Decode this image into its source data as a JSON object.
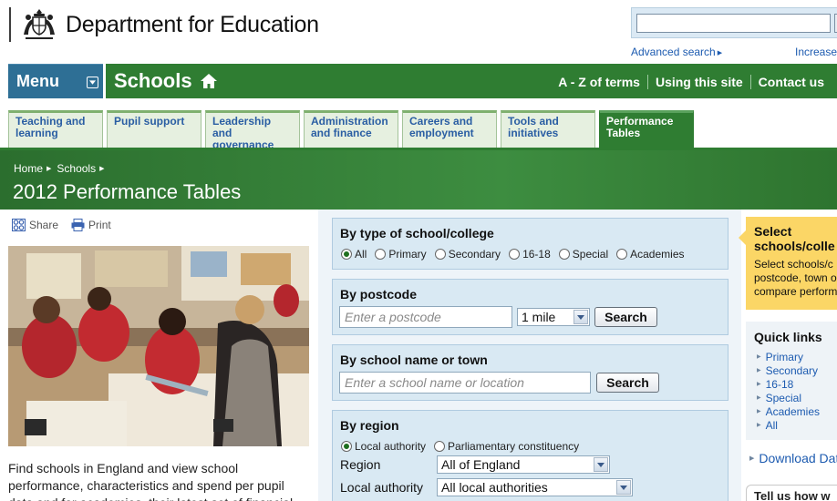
{
  "header": {
    "org_name": "Department for Education",
    "advanced_search": "Advanced search",
    "increase_text": "Increase"
  },
  "nav": {
    "menu_label": "Menu",
    "section_title": "Schools",
    "links": [
      "A - Z of terms",
      "Using this site",
      "Contact us"
    ]
  },
  "tabs": [
    {
      "label": "Teaching and learning",
      "active": false
    },
    {
      "label": "Pupil support",
      "active": false
    },
    {
      "label": "Leadership and governance",
      "active": false
    },
    {
      "label": "Administration and finance",
      "active": false
    },
    {
      "label": "Careers and employment",
      "active": false
    },
    {
      "label": "Tools and initiatives",
      "active": false
    },
    {
      "label": "Performance Tables",
      "active": true
    }
  ],
  "breadcrumb": [
    "Home",
    "Schools"
  ],
  "page_title": "2012 Performance Tables",
  "share": {
    "share_label": "Share",
    "print_label": "Print"
  },
  "intro_text": "Find schools in England and view school performance, characteristics and spend per pupil data and for academies, their latest set of financial",
  "by_type": {
    "title": "By type of school/college",
    "options": [
      "All",
      "Primary",
      "Secondary",
      "16-18",
      "Special",
      "Academies"
    ],
    "selected": "All"
  },
  "by_postcode": {
    "title": "By postcode",
    "placeholder": "Enter a postcode",
    "distance": "1 mile",
    "button": "Search"
  },
  "by_name": {
    "title": "By school name or town",
    "placeholder": "Enter a school name or location",
    "button": "Search"
  },
  "by_region": {
    "title": "By region",
    "options": [
      "Local authority",
      "Parliamentary constituency"
    ],
    "selected": "Local authority",
    "region_label": "Region",
    "region_value": "All of England",
    "la_label": "Local authority",
    "la_value": "All local authorities"
  },
  "promo": {
    "title_line1": "Select",
    "title_line2": "schools/colle",
    "lines": [
      "Select schools/c",
      "postcode, town o",
      "compare perform"
    ]
  },
  "quick_links": {
    "title": "Quick links",
    "items": [
      "Primary",
      "Secondary",
      "16-18",
      "Special",
      "Academies",
      "All"
    ]
  },
  "download_text": "Download Dat",
  "tell_us": "Tell us how w",
  "colors": {
    "green": "#2f7d32",
    "menu_blue": "#2e6f95",
    "link_blue": "#1d5bb0",
    "panel_blue": "#d9e9f3",
    "promo_yellow": "#fbd666"
  },
  "icons": [
    "crest-icon",
    "home-icon",
    "share-icon",
    "print-icon",
    "chevron-down-icon"
  ]
}
